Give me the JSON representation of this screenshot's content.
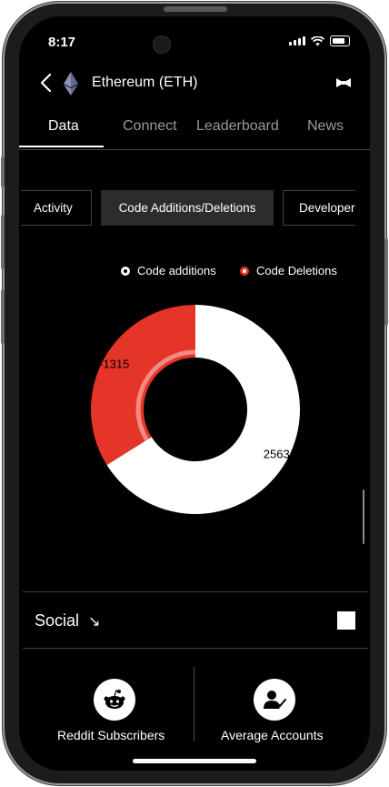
{
  "status": {
    "time": "8:17"
  },
  "header": {
    "title": "Ethereum (ETH)"
  },
  "tabs": [
    {
      "label": "Data",
      "active": true
    },
    {
      "label": "Connect"
    },
    {
      "label": "Leaderboard"
    },
    {
      "label": "News"
    }
  ],
  "chips": [
    {
      "label": "Activity"
    },
    {
      "label": "Code Additions/Deletions",
      "active": true
    },
    {
      "label": "Developers"
    }
  ],
  "legend": {
    "additions": "Code additions",
    "deletions": "Code Deletions"
  },
  "chart_data": {
    "type": "pie",
    "series": [
      {
        "name": "Code additions",
        "value": 2563,
        "label": "2563",
        "color": "#ffffff"
      },
      {
        "name": "Code Deletions",
        "value": -1315,
        "label": "-1315",
        "color": "#e53428"
      }
    ]
  },
  "social": {
    "label": "Social",
    "arrow": "↘"
  },
  "cards": [
    {
      "label": "Reddit Subscribers",
      "icon": "reddit-icon"
    },
    {
      "label": "Average Accounts",
      "icon": "user-check-icon"
    }
  ],
  "colors": {
    "accent": "#e53428",
    "background": "#000000",
    "text": "#ffffff"
  }
}
